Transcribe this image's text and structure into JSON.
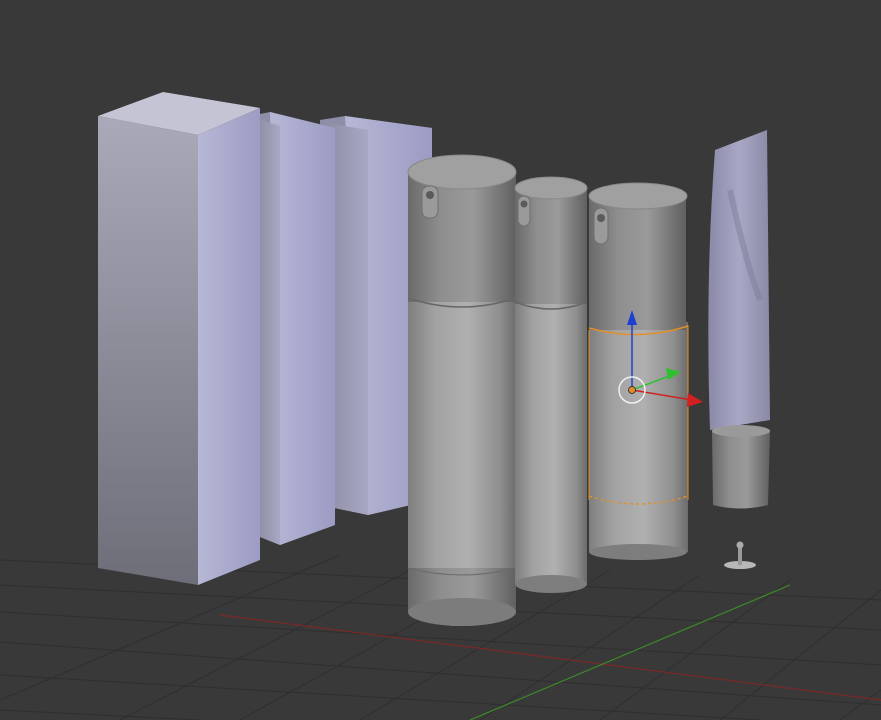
{
  "viewport": {
    "background": "#393939",
    "grid_color": "#2f2f2f",
    "x_axis_color": "#8a2a2a",
    "y_axis_color": "#3f8a2a"
  },
  "objects": [
    {
      "name": "box-large",
      "kind": "box"
    },
    {
      "name": "box-medium",
      "kind": "box"
    },
    {
      "name": "box-small",
      "kind": "box"
    },
    {
      "name": "pump-bottle-large",
      "kind": "airless-pump-bottle"
    },
    {
      "name": "pump-bottle-medium",
      "kind": "airless-pump-bottle"
    },
    {
      "name": "pump-bottle-selected",
      "kind": "airless-pump-bottle",
      "selected": true
    },
    {
      "name": "squeeze-tube",
      "kind": "tube"
    },
    {
      "name": "lamp-object",
      "kind": "light"
    }
  ],
  "gizmo": {
    "z_color": "#1f3fd0",
    "y_color": "#2fbf2f",
    "x_color": "#d02020",
    "origin_color": "#e08a2a",
    "selection_color": "#e0902a"
  }
}
